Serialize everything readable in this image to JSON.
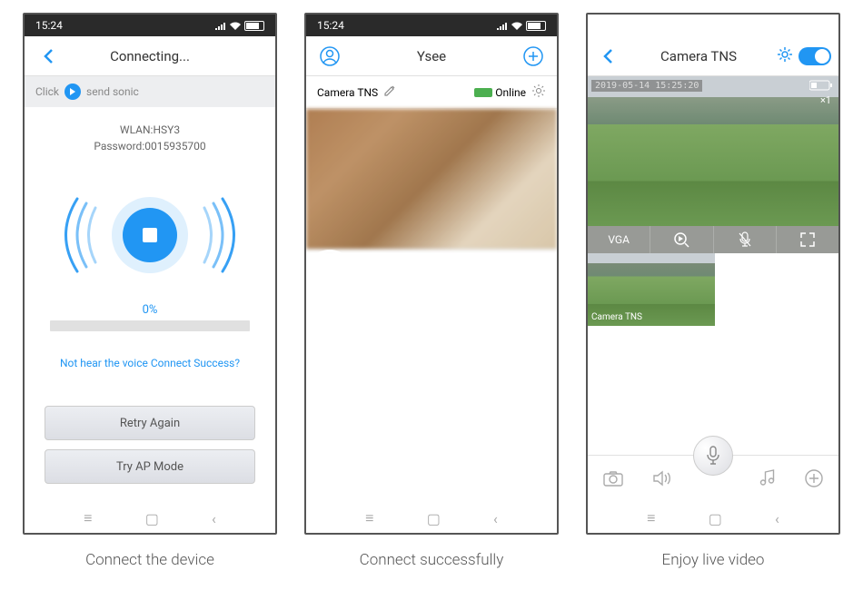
{
  "status_bar": {
    "time": "15:24",
    "battery": "87"
  },
  "phone1": {
    "title": "Connecting...",
    "click_label": "Click",
    "sonic_label": "send sonic",
    "wlan_label": "WLAN:HSY3",
    "password_label": "Password:0015935700",
    "progress": "0%",
    "help_text": "Not hear the voice Connect Success?",
    "retry_button": "Retry Again",
    "ap_button": "Try AP Mode",
    "caption": "Connect the device"
  },
  "phone2": {
    "title": "Ysee",
    "camera_name": "Camera TNS",
    "status": "Online",
    "caption": "Connect successfully"
  },
  "phone3": {
    "title": "Camera TNS",
    "timestamp": "2019-05-14 15:25:20",
    "zoom": "×1",
    "vga_label": "VGA",
    "thumb_label": "Camera TNS",
    "caption": "Enjoy live video"
  }
}
